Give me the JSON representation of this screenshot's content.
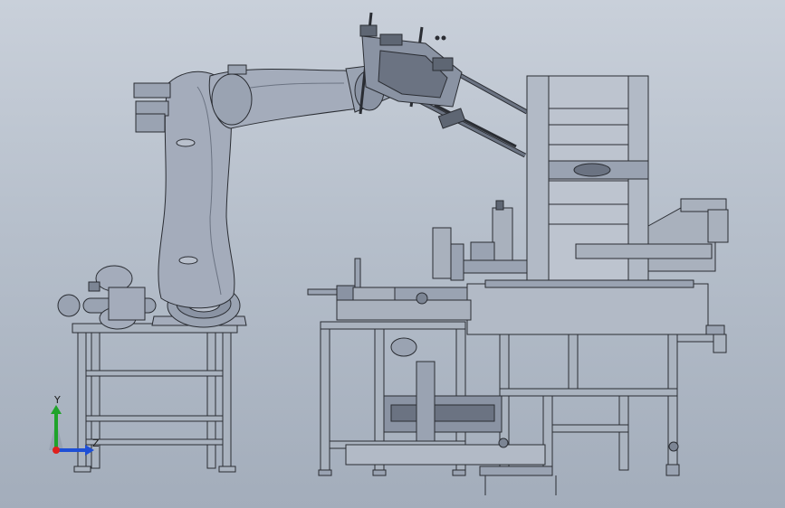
{
  "viewport": {
    "background_top": "#c9d0da",
    "background_bottom": "#a3adbb"
  },
  "colors": {
    "frame_fill": "#aab3bf",
    "frame_stroke": "#2a2d33",
    "robot_fill": "#a4acbb",
    "robot_shade": "#8a93a3",
    "machine_fill": "#b2bac6",
    "dark_part": "#5e6673"
  },
  "triad": {
    "y_label": "Y",
    "z_label": "Z",
    "x_color": "#e0201c",
    "y_color": "#1fa32a",
    "z_color": "#1e4fd6"
  },
  "model": {
    "robot_icon": "industrial-robot-arm",
    "gripper_icon": "gripper-end-effector",
    "stack_icon": "carton-magazine",
    "conveyor_icon": "conveyor-machine"
  }
}
